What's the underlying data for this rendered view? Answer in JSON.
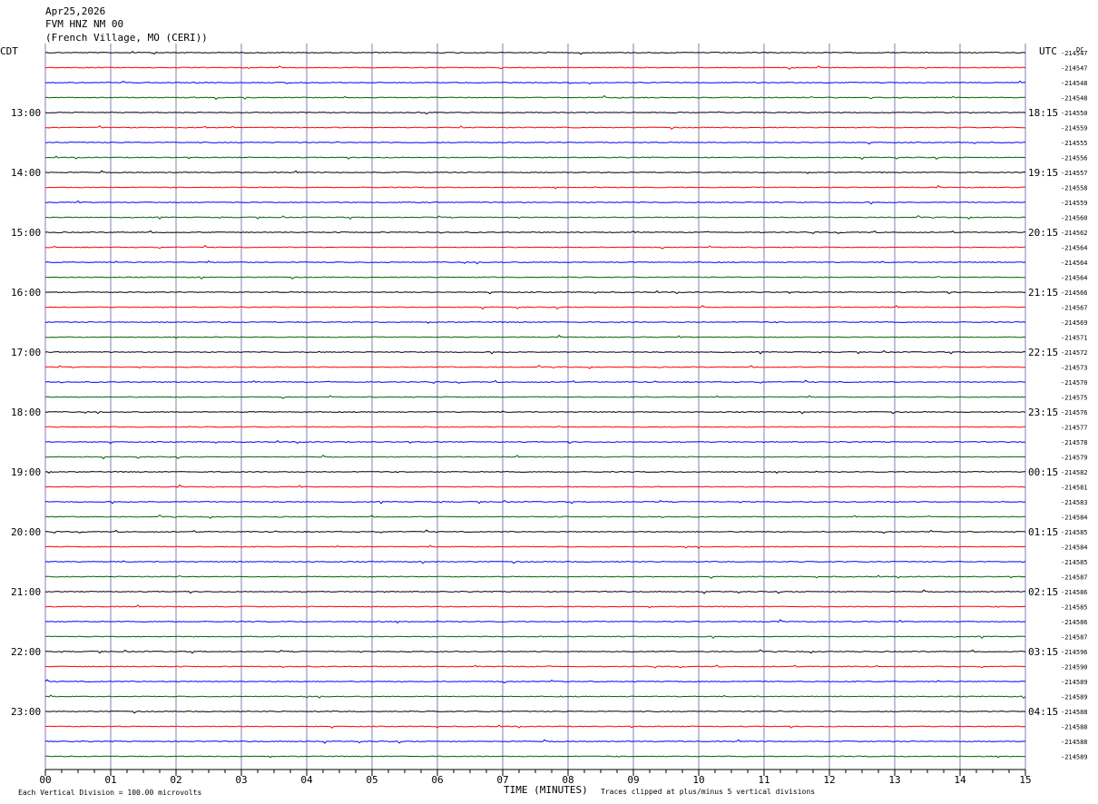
{
  "header": {
    "date": "Apr25,2026",
    "station": "FVM HNZ NM 00",
    "location": "(French Village, MO (CERI))"
  },
  "left_timezone": "CDT",
  "right_timezone": "UTC",
  "dc_label": "DC",
  "footer": {
    "scale_note": "Each Vertical Division =  100.00 microvolts",
    "clip_note": "Traces clipped at plus/minus 5 vertical divisions"
  },
  "chart_data": {
    "type": "line",
    "xlabel": "TIME (MINUTES)",
    "x_ticks": [
      "00",
      "01",
      "02",
      "03",
      "04",
      "05",
      "06",
      "07",
      "08",
      "09",
      "10",
      "11",
      "12",
      "13",
      "14",
      "15"
    ],
    "xlim": [
      0,
      15
    ],
    "trace_colors": [
      "#000000",
      "#ff0000",
      "#0000ff",
      "#006400"
    ],
    "grid_color": "#8080b0",
    "left_hour_labels": [
      "13:00",
      "14:00",
      "15:00",
      "16:00",
      "17:00",
      "18:00",
      "19:00",
      "20:00",
      "21:00",
      "22:00",
      "23:00"
    ],
    "right_hour_labels": [
      "18:15",
      "19:15",
      "20:15",
      "21:15",
      "22:15",
      "23:15",
      "00:15",
      "01:15",
      "02:15",
      "03:15",
      "04:15"
    ],
    "dc_offsets": [
      "-214547",
      "-214547",
      "-214548",
      "-214548",
      "-214550",
      "-214559",
      "-214555",
      "-214556",
      "-214557",
      "-214558",
      "-214559",
      "-214560",
      "-214562",
      "-214564",
      "-214564",
      "-214564",
      "-214566",
      "-214567",
      "-214569",
      "-214571",
      "-214572",
      "-214573",
      "-214570",
      "-214575",
      "-214576",
      "-214577",
      "-214578",
      "-214579",
      "-214582",
      "-214581",
      "-214583",
      "-214584",
      "-214585",
      "-214584",
      "-214585",
      "-214587",
      "-214586",
      "-214585",
      "-214586",
      "-214587",
      "-214596",
      "-214590",
      "-214589",
      "-214589",
      "-214588",
      "-214588",
      "-214588",
      "-214589"
    ],
    "trace_count": 48,
    "minutes_per_trace": 15
  }
}
